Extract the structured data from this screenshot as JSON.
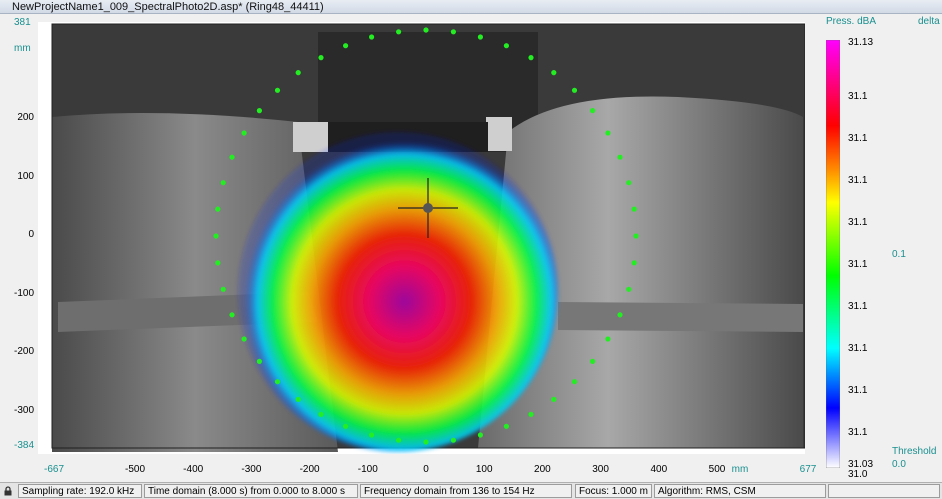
{
  "window": {
    "title": "NewProjectName1_009_SpectralPhoto2D.asp* (Ring48_44411)"
  },
  "y_axis": {
    "top_value": "381",
    "unit": "mm",
    "ticks": [
      "200",
      "100",
      "0",
      "-100",
      "-200",
      "-300"
    ],
    "bottom_value": "-384"
  },
  "x_axis": {
    "left_value": "-667",
    "ticks": [
      "-500",
      "-400",
      "-300",
      "-200",
      "-100",
      "0",
      "100",
      "200",
      "300",
      "400",
      "500"
    ],
    "unit": "mm",
    "right_value": "677"
  },
  "colorbar": {
    "header_left": "Press. dBA",
    "header_right": "delta",
    "max_value": "31.13",
    "ticks": [
      "31.1",
      "31.1",
      "31.1",
      "31.1",
      "31.1",
      "31.1",
      "31.1",
      "31.1",
      "31.1",
      "31.0"
    ],
    "min_value": "31.03",
    "delta_value": "0.1",
    "threshold_label": "Threshold",
    "threshold_value": "0.0",
    "colors": [
      "#ff00ff",
      "#ff0000",
      "#ff8800",
      "#ffff00",
      "#00ff00",
      "#00ffff",
      "#0000ff",
      "#ffffff"
    ]
  },
  "microphones": {
    "count": 48,
    "color": "#22ee22"
  },
  "heatmap_colors": [
    "#aa00aa",
    "#ff0066",
    "#ff2200",
    "#ffaa00",
    "#ddff00",
    "#00ff44",
    "#00ccff",
    "#0022ff"
  ],
  "status_bar": {
    "sampling": "Sampling rate: 192.0 kHz",
    "time_domain": "Time domain (8.000 s) from 0.000 to 8.000 s",
    "frequency_domain": "Frequency domain from 136 to 154 Hz",
    "focus": "Focus: 1.000 m",
    "algorithm": "Algorithm: RMS, CSM"
  }
}
